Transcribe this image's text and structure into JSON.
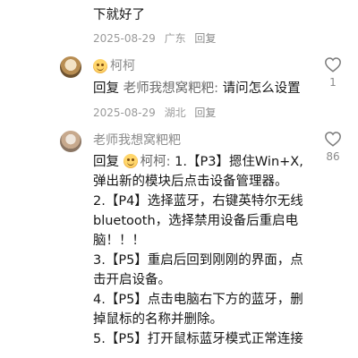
{
  "top_comment": {
    "text_fragment": "下就好了",
    "date": "2025-08-29",
    "location": "广东",
    "reply_label": "回复"
  },
  "comments": [
    {
      "avatar_icon": "user-avatar",
      "emoji_icon": "smile-emoji-icon",
      "username": "柯柯",
      "reply_prefix": "回复",
      "reply_to": "老师我想窝粑粑:",
      "text": "请问怎么设置",
      "date": "2025-08-29",
      "location": "湖北",
      "reply_label": "回复",
      "likes": "1"
    },
    {
      "avatar_icon": "user-avatar",
      "username": "老师我想窝粑粑",
      "reply_prefix": "回复",
      "reply_to_emoji_icon": "smile-emoji-icon",
      "reply_to": "柯柯:",
      "likes": "86",
      "lines": [
        "1.【P3】摁住Win+X,",
        "弹出新的模块后点击设备管理器。",
        "2.【P4】选择蓝牙，右键英特尔无线",
        "bluetooth，选择禁用设备后重启电",
        "脑！！！",
        "3.【P5】重启后回到刚刚的界面，点",
        "击开启设备。",
        "4.【P5】点击电脑右下方的蓝牙，删",
        "掉鼠标的名称并删除。",
        "5.【P5】打开鼠标蓝牙模式正常连接"
      ]
    }
  ],
  "colors": {
    "text": "#161616",
    "meta": "#9a9a9a",
    "username": "#8b8b8b"
  }
}
